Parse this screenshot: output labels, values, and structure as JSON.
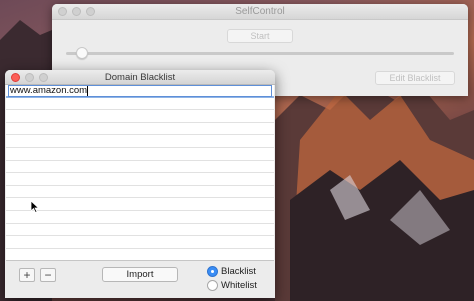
{
  "selfcontrol": {
    "title": "SelfControl",
    "start_label": "Start",
    "edit_blacklist_label": "Edit Blacklist"
  },
  "blacklist_window": {
    "title": "Domain Blacklist",
    "entries": [
      "www.amazon.com"
    ],
    "add_label": "+",
    "remove_label": "−",
    "import_label": "Import",
    "mode_options": [
      "Blacklist",
      "Whitelist"
    ],
    "selected_mode": "Blacklist"
  },
  "colors": {
    "accent": "#3a8df5",
    "close_button": "#fc5f57"
  }
}
